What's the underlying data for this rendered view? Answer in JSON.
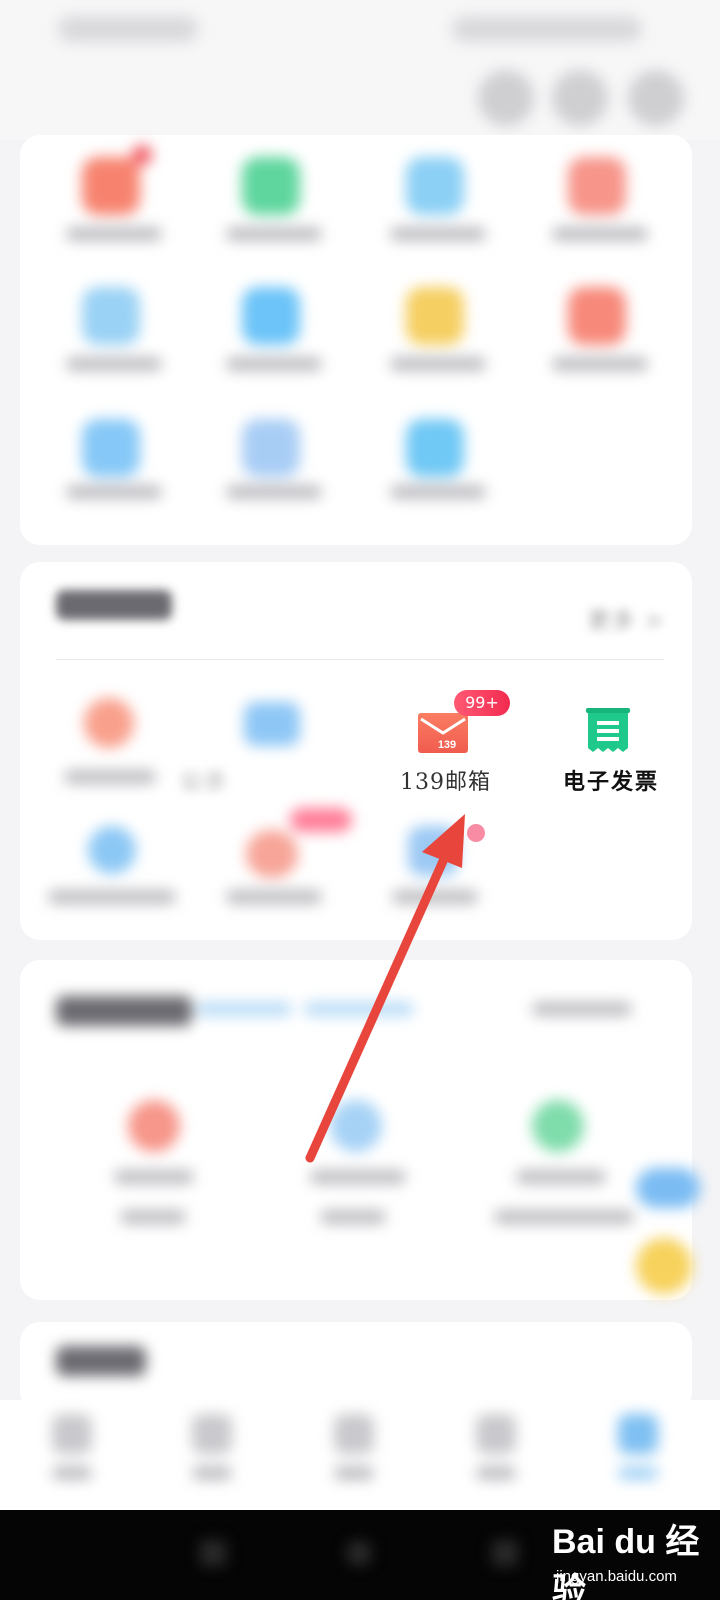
{
  "service_section": {
    "more_link": "更多 >",
    "items": [
      {
        "label": "139邮箱",
        "badge": "99+",
        "icon": "mail-icon"
      },
      {
        "label": "电子发票",
        "icon": "invoice-icon"
      }
    ],
    "partial_visible_label": "公示"
  },
  "watermark": {
    "brand": "Bai du 经验",
    "url": "jingyan.baidu.com"
  },
  "colors": {
    "badge": "#f22a50",
    "mail_icon": "#f5665a",
    "invoice_icon": "#1ec98b",
    "arrow": "#e8453c"
  }
}
